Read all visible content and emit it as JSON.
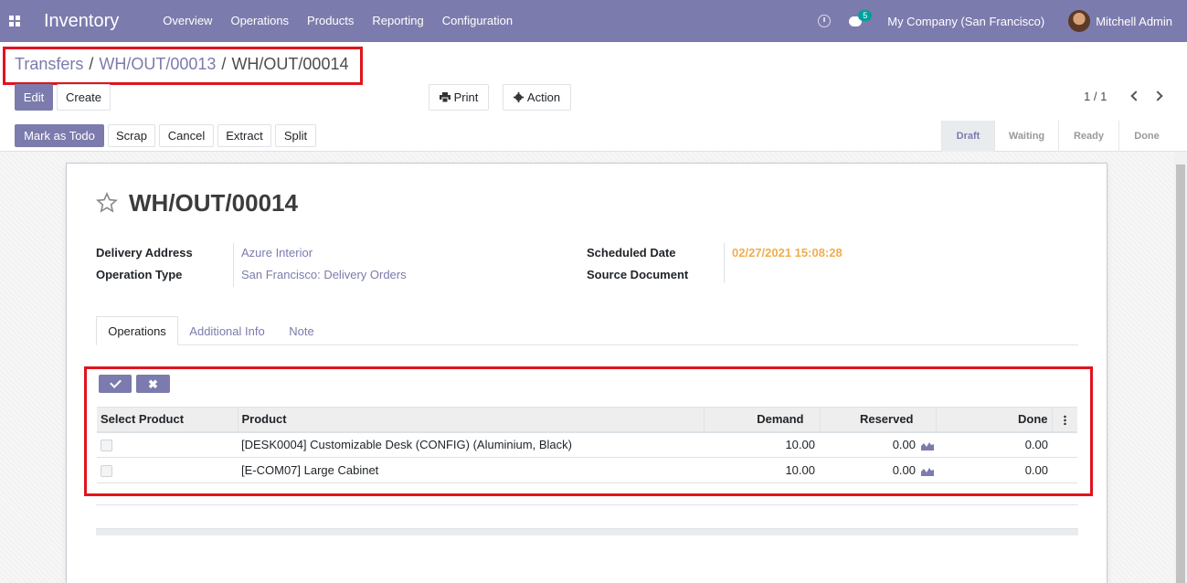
{
  "navbar": {
    "app_name": "Inventory",
    "menu": [
      "Overview",
      "Operations",
      "Products",
      "Reporting",
      "Configuration"
    ],
    "chat_count": "5",
    "company": "My Company (San Francisco)",
    "user": "Mitchell Admin",
    "bg_color": "#7c7bad"
  },
  "breadcrumb": {
    "items": [
      "Transfers",
      "WH/OUT/00013",
      "WH/OUT/00014"
    ],
    "sep": "/"
  },
  "toolbar": {
    "edit": "Edit",
    "create": "Create",
    "print": "Print",
    "action": "Action",
    "pager": "1 / 1"
  },
  "statusbar": {
    "buttons": [
      "Mark as Todo",
      "Scrap",
      "Cancel",
      "Extract",
      "Split"
    ],
    "stages": [
      "Draft",
      "Waiting",
      "Ready",
      "Done"
    ],
    "active_stage": "Draft"
  },
  "record": {
    "title": "WH/OUT/00014",
    "fields": {
      "delivery_address_label": "Delivery Address",
      "delivery_address": "Azure Interior",
      "operation_type_label": "Operation Type",
      "operation_type": "San Francisco: Delivery Orders",
      "scheduled_date_label": "Scheduled Date",
      "scheduled_date": "02/27/2021 15:08:28",
      "source_document_label": "Source Document"
    }
  },
  "tabs": [
    "Operations",
    "Additional Info",
    "Note"
  ],
  "operations": {
    "columns": [
      "Select Product",
      "Product",
      "Demand",
      "Reserved",
      "Done"
    ],
    "rows": [
      {
        "product": "[DESK0004] Customizable Desk (CONFIG) (Aluminium, Black)",
        "demand": "10.00",
        "reserved": "0.00",
        "done": "0.00"
      },
      {
        "product": "[E-COM07] Large Cabinet",
        "demand": "10.00",
        "reserved": "0.00",
        "done": "0.00"
      }
    ]
  },
  "colors": {
    "accent": "#7c7bad",
    "highlight_box": "#e0141e",
    "date_warning": "#f0ad4e"
  }
}
